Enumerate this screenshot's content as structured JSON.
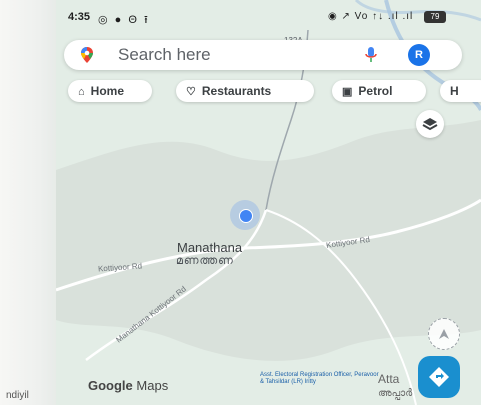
{
  "status_bar": {
    "time": "4:35",
    "left_icons": "◎ ● Θ ⭱",
    "right_icons": "◉ ↗ Vo ↑↓ .ıl .ıl",
    "battery": "79"
  },
  "search": {
    "placeholder": "Search here"
  },
  "account": {
    "initial": "R"
  },
  "chips": {
    "home": "Home",
    "restaurants": "Restaurants",
    "petrol": "Petrol",
    "more": "H"
  },
  "map": {
    "top_road_label": "132A",
    "place_name": "Manathana",
    "place_name_native": "മണത്തണ",
    "road_left": "Kottiyoor Rd",
    "road_right": "Kottiyoor Rd",
    "road_diag": "Manathana Kottiyoor Rd",
    "google_logo_google": "Google",
    "google_logo_maps": "Maps",
    "bottom_left_place": "ndiyil",
    "poi_label": "Asst. Electoral Registration Officer, Peravoor & Tahsildar (LR) Iritty",
    "bottom_right_place": "Atta",
    "bottom_right_native": "അപ്പാർ"
  },
  "colors": {
    "accent_blue": "#1a73e8",
    "map_land": "#e3ede6",
    "nav_button": "#1a8fcf"
  },
  "icons": {
    "maps_pin": "maps-pin-icon",
    "mic": "mic-icon",
    "home": "home-icon",
    "restaurant": "restaurant-icon",
    "petrol": "gas-station-icon",
    "layers": "layers-icon",
    "compass": "compass-icon",
    "navigate": "navigation-icon"
  }
}
